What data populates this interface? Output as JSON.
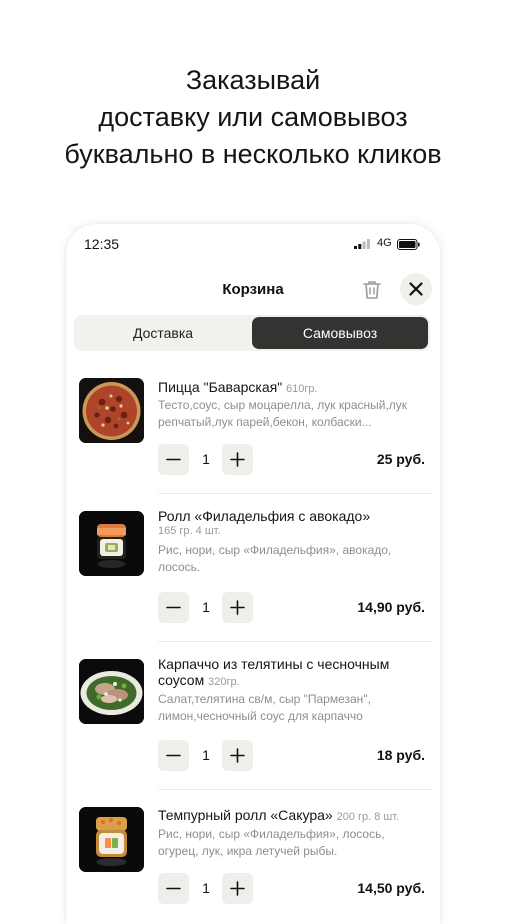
{
  "headline": {
    "line1": "Заказывай",
    "line2": "доставку или самовывоз",
    "line3": "буквально в несколько кликов"
  },
  "status_bar": {
    "time": "12:35",
    "network": "4G"
  },
  "cart": {
    "title": "Корзина",
    "tabs": {
      "delivery": "Доставка",
      "pickup": "Самовывоз",
      "selected": "pickup"
    },
    "items": [
      {
        "name": "Пицца \"Баварская\"",
        "weight": "610гр.",
        "description": "Тесто,соус, сыр моцарелла, лук красный,лук репчатый,лук парей,бекон, колбаски...",
        "quantity": "1",
        "price": "25 руб."
      },
      {
        "name": "Ролл «Филадельфия с авокадо»",
        "weight": "165 гр. 4 шт.",
        "description": "Рис, нори, сыр «Филадельфия», авокадо, лосось.",
        "quantity": "1",
        "price": "14,90 руб."
      },
      {
        "name_line1": "Карпаччо из телятины с чесночным",
        "name_line2": "соусом",
        "weight": "320гр.",
        "description": "Салат,телятина св/м, сыр \"Пармезан\", лимон,чесночный соус для карпаччо",
        "quantity": "1",
        "price": "18 руб."
      },
      {
        "name": "Темпурный ролл «Сакура»",
        "weight": "200 гр. 8 шт.",
        "description": "Рис, нори, сыр «Филадельфия», лосось, огурец, лук, икра летучей рыбы.",
        "quantity": "1",
        "price": "14,50 руб."
      }
    ]
  },
  "icons": {
    "trash": "trash-icon",
    "close": "close-icon",
    "minus": "minus-icon",
    "plus": "plus-icon",
    "signal": "signal-icon",
    "battery": "battery-icon"
  },
  "colors": {
    "segment_selected": "#333331",
    "segment_background": "#f2f1ed",
    "button_background": "#efeeea"
  }
}
